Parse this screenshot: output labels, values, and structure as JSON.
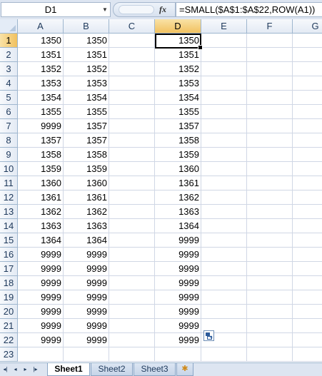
{
  "formula_bar": {
    "name_box": "D1",
    "fx_label": "fx",
    "formula": "=SMALL($A$1:$A$22,ROW(A1))"
  },
  "columns": [
    "A",
    "B",
    "C",
    "D",
    "E",
    "F",
    "G"
  ],
  "selected_column": "D",
  "selected_row": "1",
  "rows": [
    {
      "num": "1",
      "A": "1350",
      "B": "1350",
      "C": "",
      "D": "1350"
    },
    {
      "num": "2",
      "A": "1351",
      "B": "1351",
      "C": "",
      "D": "1351"
    },
    {
      "num": "3",
      "A": "1352",
      "B": "1352",
      "C": "",
      "D": "1352"
    },
    {
      "num": "4",
      "A": "1353",
      "B": "1353",
      "C": "",
      "D": "1353"
    },
    {
      "num": "5",
      "A": "1354",
      "B": "1354",
      "C": "",
      "D": "1354"
    },
    {
      "num": "6",
      "A": "1355",
      "B": "1355",
      "C": "",
      "D": "1355"
    },
    {
      "num": "7",
      "A": "9999",
      "B": "1357",
      "C": "",
      "D": "1357"
    },
    {
      "num": "8",
      "A": "1357",
      "B": "1357",
      "C": "",
      "D": "1358"
    },
    {
      "num": "9",
      "A": "1358",
      "B": "1358",
      "C": "",
      "D": "1359"
    },
    {
      "num": "10",
      "A": "1359",
      "B": "1359",
      "C": "",
      "D": "1360"
    },
    {
      "num": "11",
      "A": "1360",
      "B": "1360",
      "C": "",
      "D": "1361"
    },
    {
      "num": "12",
      "A": "1361",
      "B": "1361",
      "C": "",
      "D": "1362"
    },
    {
      "num": "13",
      "A": "1362",
      "B": "1362",
      "C": "",
      "D": "1363"
    },
    {
      "num": "14",
      "A": "1363",
      "B": "1363",
      "C": "",
      "D": "1364"
    },
    {
      "num": "15",
      "A": "1364",
      "B": "1364",
      "C": "",
      "D": "9999"
    },
    {
      "num": "16",
      "A": "9999",
      "B": "9999",
      "C": "",
      "D": "9999"
    },
    {
      "num": "17",
      "A": "9999",
      "B": "9999",
      "C": "",
      "D": "9999"
    },
    {
      "num": "18",
      "A": "9999",
      "B": "9999",
      "C": "",
      "D": "9999"
    },
    {
      "num": "19",
      "A": "9999",
      "B": "9999",
      "C": "",
      "D": "9999"
    },
    {
      "num": "20",
      "A": "9999",
      "B": "9999",
      "C": "",
      "D": "9999"
    },
    {
      "num": "21",
      "A": "9999",
      "B": "9999",
      "C": "",
      "D": "9999"
    },
    {
      "num": "22",
      "A": "9999",
      "B": "9999",
      "C": "",
      "D": "9999"
    },
    {
      "num": "23",
      "A": "",
      "B": "",
      "C": "",
      "D": ""
    }
  ],
  "sheet_tabs": {
    "tabs": [
      "Sheet1",
      "Sheet2",
      "Sheet3"
    ],
    "active": "Sheet1",
    "nav_icons": [
      "first-sheet-icon",
      "prev-sheet-icon",
      "next-sheet-icon",
      "last-sheet-icon"
    ],
    "new_sheet_icon": "insert-sheet-icon"
  },
  "colors": {
    "selection_header": "#f1c15f",
    "header_text": "#1e395b",
    "gridline": "#d0d7e5"
  }
}
